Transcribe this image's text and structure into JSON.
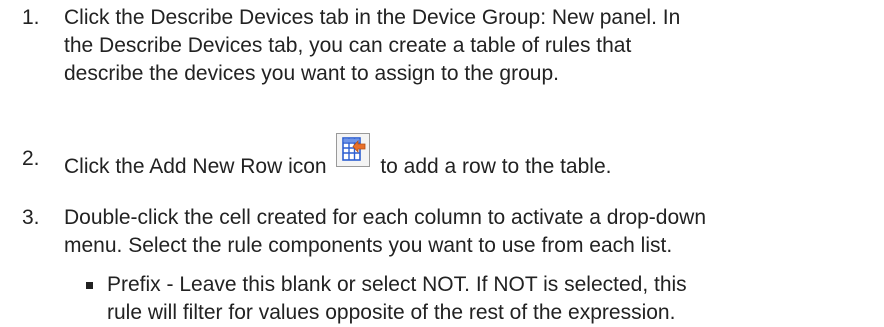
{
  "steps": [
    {
      "number": "1.",
      "lines": [
        "Click the Describe Devices tab in the Device Group: New panel. In",
        "the Describe Devices tab, you can create a table of rules that",
        "describe the devices you want to assign to the group."
      ]
    },
    {
      "number": "2.",
      "before_icon": "Click the Add New Row icon",
      "icon": "add-new-row-icon",
      "after_icon": "to add a row to the table."
    },
    {
      "number": "3.",
      "lines": [
        "Double-click the cell created for each column to activate a drop-down",
        "menu. Select the rule components you want to use from each list."
      ]
    }
  ],
  "bullets": [
    {
      "lines": [
        "Prefix - Leave this blank or select NOT. If NOT is selected, this",
        "rule will filter for values opposite of the rest of the expression."
      ]
    }
  ],
  "colors": {
    "text": "#222222",
    "icon_blue": "#2d5fd1",
    "icon_orange": "#e8702a"
  }
}
